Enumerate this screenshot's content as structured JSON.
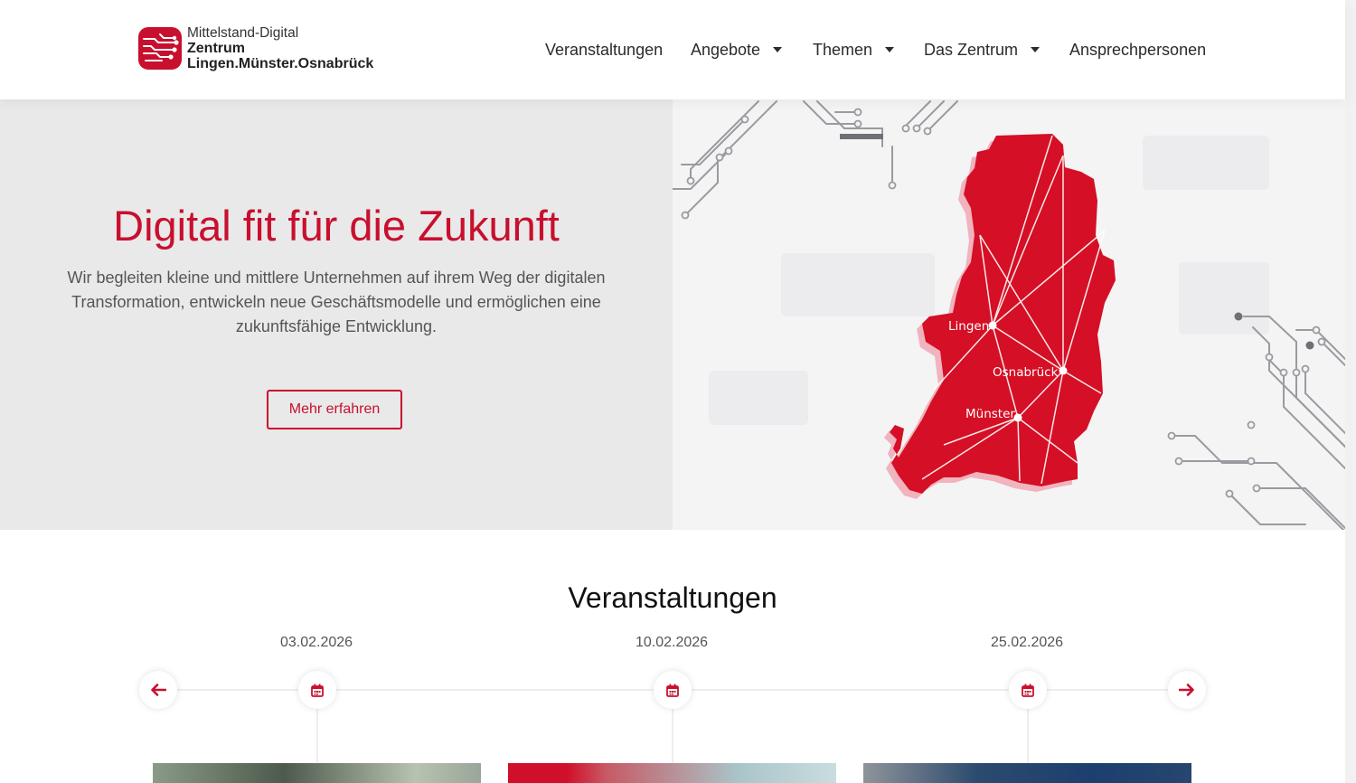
{
  "header": {
    "logo": {
      "line1": "Mittelstand-Digital",
      "line2": "Zentrum",
      "line3": "Lingen.Münster.Osnabrück"
    },
    "nav": [
      {
        "label": "Veranstaltungen",
        "has_dropdown": false
      },
      {
        "label": "Angebote",
        "has_dropdown": true
      },
      {
        "label": "Themen",
        "has_dropdown": true
      },
      {
        "label": "Das Zentrum",
        "has_dropdown": true
      },
      {
        "label": "Ansprechpersonen",
        "has_dropdown": false
      }
    ]
  },
  "hero": {
    "title": "Digital fit für die Zukunft",
    "text": "Wir begleiten kleine und mittlere Unternehmen auf ihrem Weg der digitalen Transformation, entwickeln neue Geschäftsmodelle und ermöglichen eine zukunftsfähige Entwicklung.",
    "button": "Mehr erfahren",
    "map_labels": {
      "lingen": "Lingen",
      "osnabrueck": "Osnabrück",
      "muenster": "Münster"
    }
  },
  "events": {
    "title": "Veranstaltungen",
    "items": [
      {
        "date": "03.02.2026",
        "icon": "calendar-icon"
      },
      {
        "date": "10.02.2026",
        "icon": "calendar-icon"
      },
      {
        "date": "25.02.2026",
        "icon": "calendar-icon"
      }
    ],
    "prev_icon": "arrow-left-icon",
    "next_icon": "arrow-right-icon"
  },
  "colors": {
    "brand_red": "#c8102e",
    "hero_bg": "#e9e9ea",
    "text_gray": "#555555"
  }
}
